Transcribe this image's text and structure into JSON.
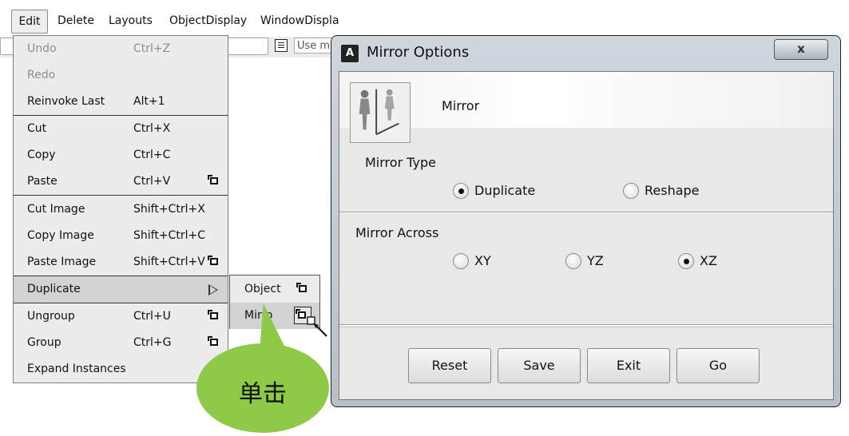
{
  "menubar": {
    "items": [
      "Edit",
      "Delete",
      "Layouts",
      "ObjectDisplay",
      "WindowDispla"
    ],
    "search_placeholder": "Use m"
  },
  "edit_menu": {
    "items": [
      {
        "label": "Undo",
        "shortcut": "Ctrl+Z",
        "disabled": true
      },
      {
        "label": "Redo",
        "shortcut": "",
        "disabled": true
      },
      {
        "label": "Reinvoke Last",
        "shortcut": "Alt+1"
      },
      {
        "label": "Cut",
        "shortcut": "Ctrl+X"
      },
      {
        "label": "Copy",
        "shortcut": "Ctrl+C"
      },
      {
        "label": "Paste",
        "shortcut": "Ctrl+V",
        "options": true
      },
      {
        "label": "Cut Image",
        "shortcut": "Shift+Ctrl+X"
      },
      {
        "label": "Copy Image",
        "shortcut": "Shift+Ctrl+C"
      },
      {
        "label": "Paste Image",
        "shortcut": "Shift+Ctrl+V",
        "options": true
      },
      {
        "label": "Duplicate",
        "submenu": true,
        "highlighted": true
      },
      {
        "label": "Ungroup",
        "shortcut": "Ctrl+U",
        "options": true
      },
      {
        "label": "Group",
        "shortcut": "Ctrl+G",
        "options": true
      },
      {
        "label": "Expand Instances",
        "shortcut": ""
      }
    ]
  },
  "submenu": {
    "items": [
      "Object",
      "Mirro"
    ]
  },
  "callout": {
    "text": "单击",
    "color": "#8ec948"
  },
  "dialog": {
    "app_icon": "A",
    "title": "Mirror Options",
    "close_label": "x",
    "header_title": "Mirror",
    "mirror_type": {
      "label": "Mirror Type",
      "options": [
        "Duplicate",
        "Reshape"
      ],
      "selected": "Duplicate"
    },
    "mirror_across": {
      "label": "Mirror Across",
      "options": [
        "XY",
        "YZ",
        "XZ"
      ],
      "selected": "XZ"
    },
    "buttons": [
      "Reset",
      "Save",
      "Exit",
      "Go"
    ]
  }
}
